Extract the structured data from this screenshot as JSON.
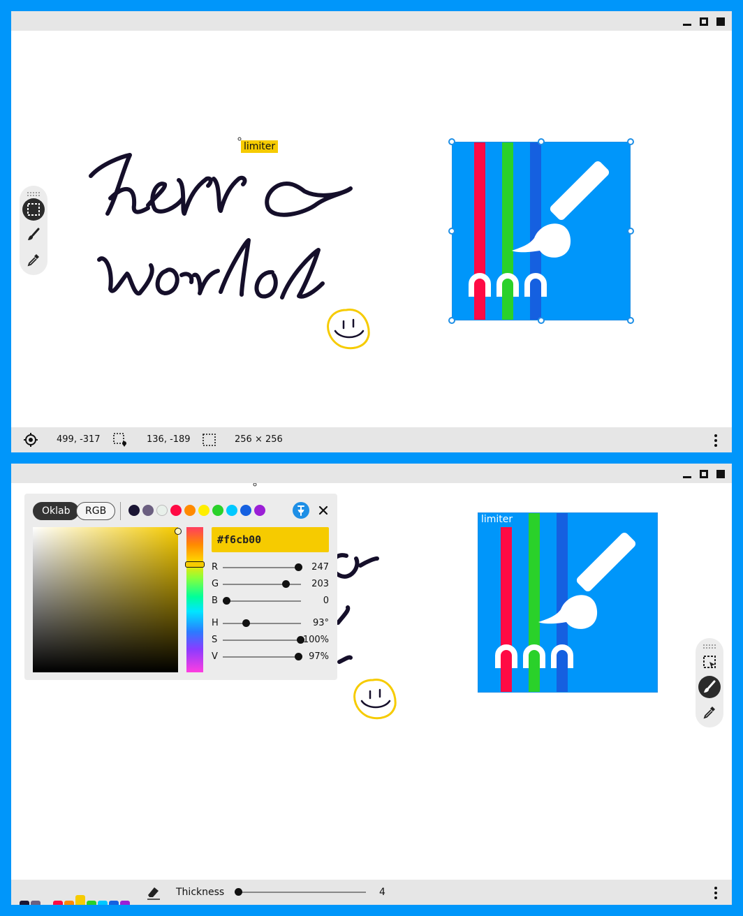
{
  "window1": {
    "canvas": {
      "handwriting_line1": "herro",
      "handwriting_line2": "worlol",
      "limiter_label": "limiter"
    },
    "status": {
      "cursor_position": "499, -317",
      "selection_position": "136, -189",
      "selection_size": "256 × 256"
    }
  },
  "window2": {
    "canvas": {
      "limiter_label": "limiter"
    },
    "color_picker": {
      "modes": [
        "Oklab",
        "RGB"
      ],
      "active_mode": "Oklab",
      "swatches": [
        "#1a1533",
        "#6b5f80",
        "#e8f0ea",
        "#ff0a44",
        "#ff8a00",
        "#ffee00",
        "#2ad12a",
        "#00c8ff",
        "#1560e0",
        "#9b1fd6"
      ],
      "hex": "#f6cb00",
      "sliders": [
        {
          "label": "R",
          "value": "247",
          "fraction": 0.97
        },
        {
          "label": "G",
          "value": "203",
          "fraction": 0.8
        },
        {
          "label": "B",
          "value": "0",
          "fraction": 0.0
        },
        {
          "label": "H",
          "value": "93°",
          "fraction": 0.26
        },
        {
          "label": "S",
          "value": "100%",
          "fraction": 1.0
        },
        {
          "label": "V",
          "value": "97%",
          "fraction": 0.97
        }
      ]
    },
    "bottom": {
      "thickness_label": "Thickness",
      "thickness_value": "4",
      "palette": [
        "#1a1533",
        "#6b5f80",
        "#ff0a44",
        "#ff8a00",
        "#f6cb00",
        "#2ad12a",
        "#00c8ff",
        "#1560e0",
        "#9b1fd6"
      ]
    }
  },
  "colors": {
    "frame": "#0096fa",
    "ink": "#150f2a",
    "accent_yellow": "#f6cb00",
    "selection_blue": "#1e8fe6"
  },
  "icons": [
    "minimize-icon",
    "maximize-icon",
    "close-icon",
    "crosshair-icon",
    "selection-pin-icon",
    "selection-rect-icon",
    "more-icon",
    "grip-icon",
    "select-tool-icon",
    "brush-tool-icon",
    "eyedropper-tool-icon",
    "pin-icon",
    "eraser-icon"
  ]
}
